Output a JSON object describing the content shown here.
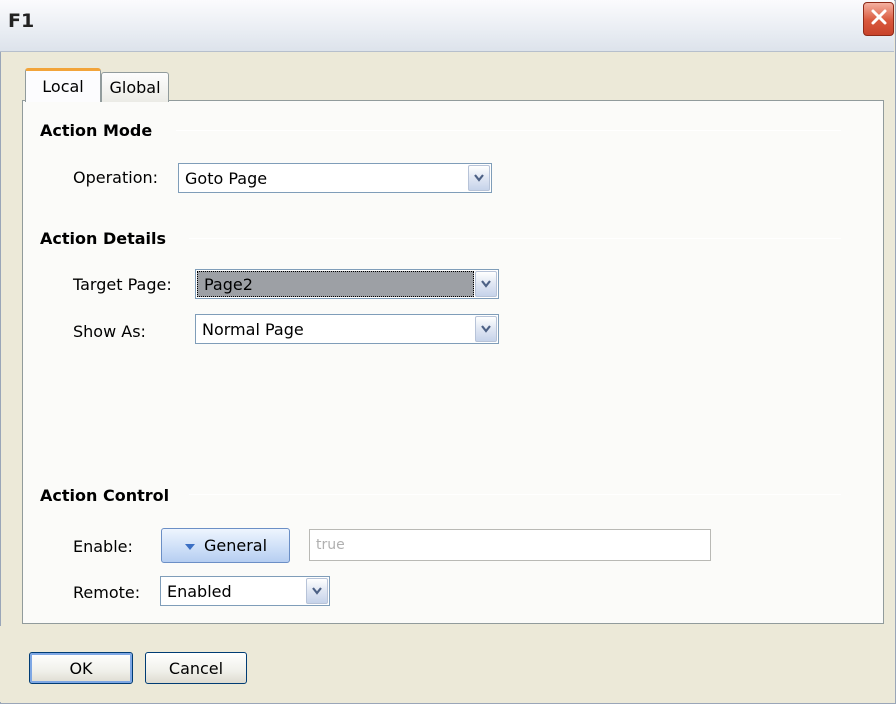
{
  "window": {
    "title": "F1"
  },
  "tabs": [
    {
      "label": "Local",
      "selected": true
    },
    {
      "label": "Global",
      "selected": false
    }
  ],
  "action_mode": {
    "heading": "Action Mode",
    "operation_label": "Operation:",
    "operation_value": "Goto Page"
  },
  "action_details": {
    "heading": "Action Details",
    "target_page_label": "Target Page:",
    "target_page_value": "Page2",
    "show_as_label": "Show As:",
    "show_as_value": "Normal Page"
  },
  "action_control": {
    "heading": "Action Control",
    "enable_label": "Enable:",
    "enable_mode": "General",
    "enable_expression": "true",
    "remote_label": "Remote:",
    "remote_value": "Enabled"
  },
  "buttons": {
    "ok": "OK",
    "cancel": "Cancel"
  },
  "icons": {
    "close": "close-icon",
    "dropdown": "chevron-down-icon",
    "mode": "triangle-down-icon"
  },
  "colors": {
    "tab_accent": "#f2a43a",
    "close": "#d9583c",
    "selection": "#9da0a5"
  }
}
